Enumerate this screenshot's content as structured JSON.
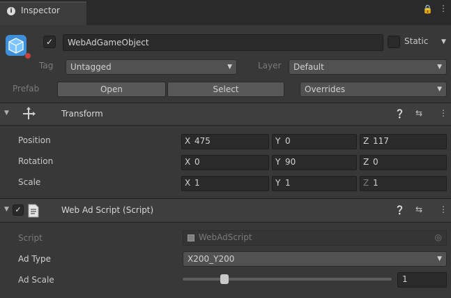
{
  "tab": {
    "title": "Inspector",
    "lock_icon": "lock-icon",
    "menu_icon": "kebab-icon"
  },
  "header": {
    "object_name": "WebAdGameObject",
    "static_label": "Static",
    "tag_label": "Tag",
    "tag_value": "Untagged",
    "layer_label": "Layer",
    "layer_value": "Default",
    "prefab_label": "Prefab",
    "open_label": "Open",
    "select_label": "Select",
    "overrides_label": "Overrides"
  },
  "transform": {
    "title": "Transform",
    "rows": [
      {
        "label": "Position",
        "x": "475",
        "y": "0",
        "z": "117"
      },
      {
        "label": "Rotation",
        "x": "0",
        "y": "90",
        "z": "0"
      },
      {
        "label": "Scale",
        "x": "1",
        "y": "1",
        "z": "1"
      }
    ],
    "axes": {
      "x": "X",
      "y": "Y",
      "z": "Z"
    }
  },
  "script_component": {
    "title": "Web Ad Script (Script)",
    "script_label": "Script",
    "script_value": "WebAdScript",
    "ad_type_label": "Ad Type",
    "ad_type_value": "X200_Y200",
    "ad_scale_label": "Ad Scale",
    "ad_scale_value": "1",
    "ad_scale_fraction": 0.2
  }
}
